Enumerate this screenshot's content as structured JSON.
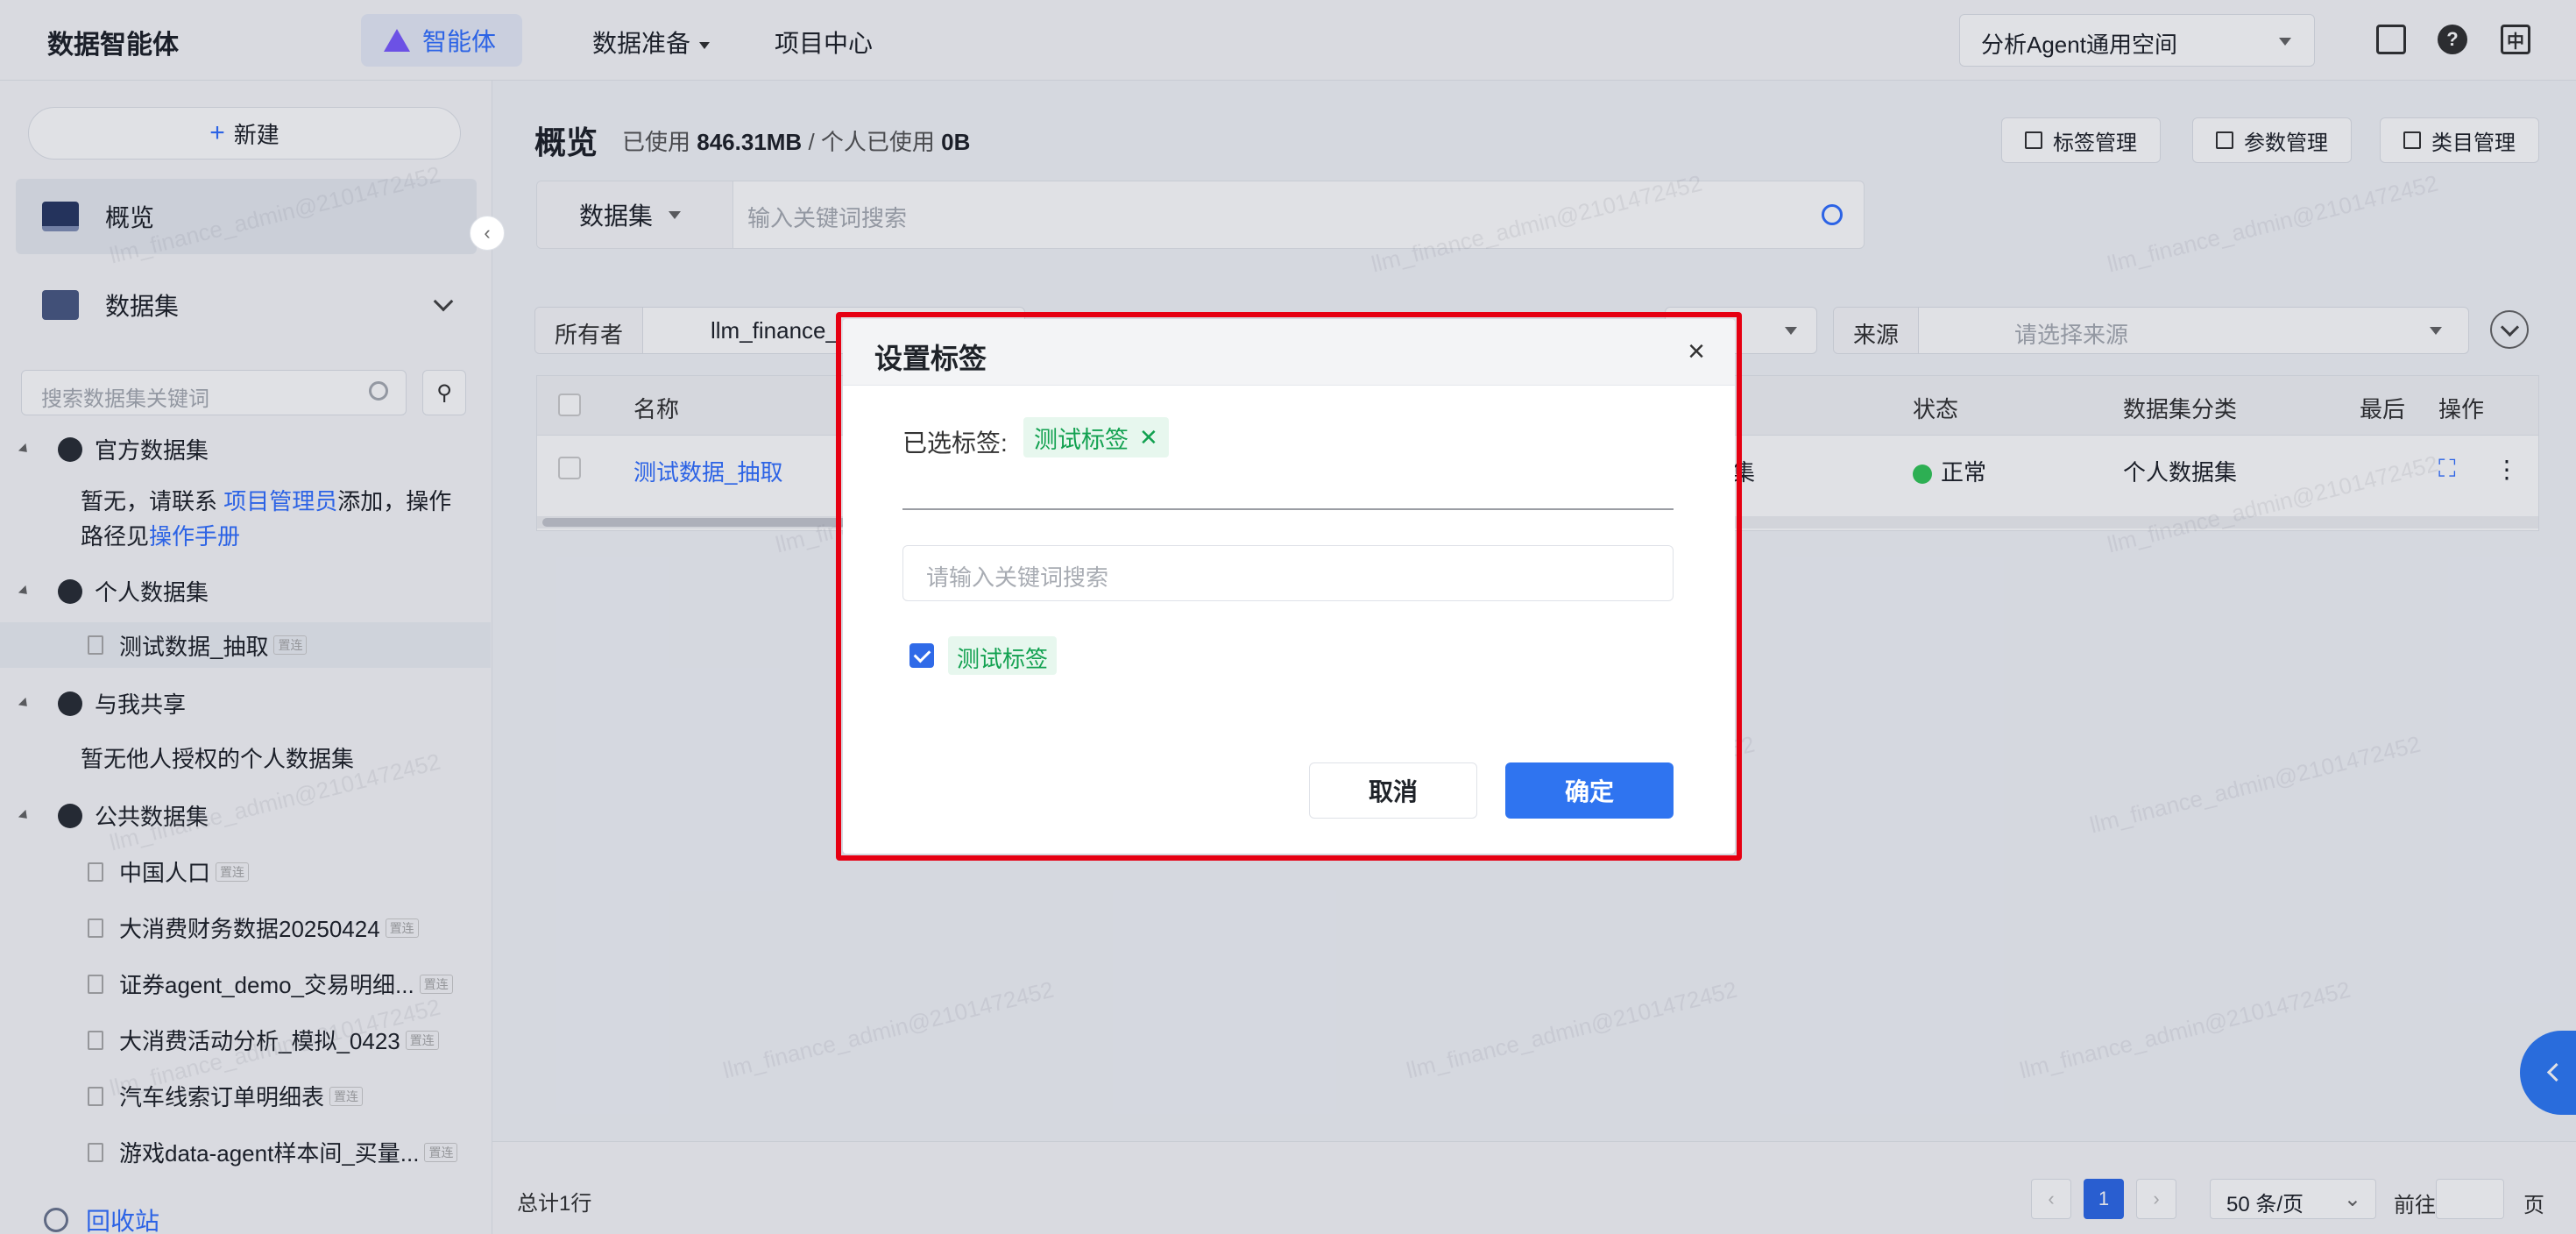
{
  "topbar": {
    "brand": "数据智能体",
    "nav": [
      {
        "label": "智能体"
      },
      {
        "label": "数据准备"
      },
      {
        "label": "项目中心"
      }
    ],
    "space": "分析Agent通用空间",
    "icons": [
      "monitor-icon",
      "help-icon",
      "language-icon"
    ],
    "lang": "中",
    "help": "?"
  },
  "sidebar": {
    "new_label": "新建",
    "overview": "概览",
    "datasets": "数据集",
    "search_placeholder": "搜索数据集关键词",
    "official": {
      "title": "官方数据集",
      "empty_prefix": "暂无，请联系",
      "contact_link": "项目管理员",
      "empty_mid": "添加，操作路径见",
      "manual_link": "操作手册"
    },
    "personal": {
      "title": "个人数据集",
      "items": [
        "测试数据_抽取"
      ]
    },
    "shared": {
      "title": "与我共享",
      "empty": "暂无他人授权的个人数据集"
    },
    "public": {
      "title": "公共数据集",
      "items": [
        "中国人口",
        "大消费财务数据20250424",
        "证券agent_demo_交易明细...",
        "大消费活动分析_模拟_0423",
        "汽车线索订单明细表",
        "游戏data-agent样本间_买量..."
      ]
    },
    "mini_tag": "置连",
    "recycle": "回收站"
  },
  "main": {
    "title": "概览",
    "usage_prefix": "已使用",
    "usage_total": "846.31MB",
    "usage_sep": "/ 个人已使用",
    "usage_personal": "0B",
    "actions": [
      "标签管理",
      "参数管理",
      "类目管理"
    ],
    "search_type": "数据集",
    "search_placeholder": "输入关键词搜索",
    "filters": {
      "owner_label": "所有者",
      "owner_value": "llm_finance_",
      "source_label": "来源",
      "source_placeholder": "请选择来源"
    },
    "table": {
      "headers": [
        "名称",
        "状态",
        "数据集分类",
        "最后",
        "操作"
      ],
      "rows": [
        {
          "name": "测试数据_抽取",
          "partial": "集",
          "status": "正常",
          "category": "个人数据集"
        }
      ]
    },
    "footer": {
      "total": "总计1行",
      "page": "1",
      "page_size": "50 条/页",
      "goto": "前往",
      "page_unit": "页"
    }
  },
  "modal": {
    "title": "设置标签",
    "selected_label": "已选标签:",
    "selected_tag": "测试标签",
    "search_placeholder": "请输入关键词搜索",
    "option_tag": "测试标签",
    "option_checked": true,
    "cancel": "取消",
    "confirm": "确定"
  },
  "watermark": "llm_finance_admin@2101472452",
  "colors": {
    "primary": "#2f74f0",
    "tag_green": "#12a150",
    "tag_bg": "#e7f7ee",
    "highlight_red": "#e60012",
    "status_ok": "#34c759"
  }
}
